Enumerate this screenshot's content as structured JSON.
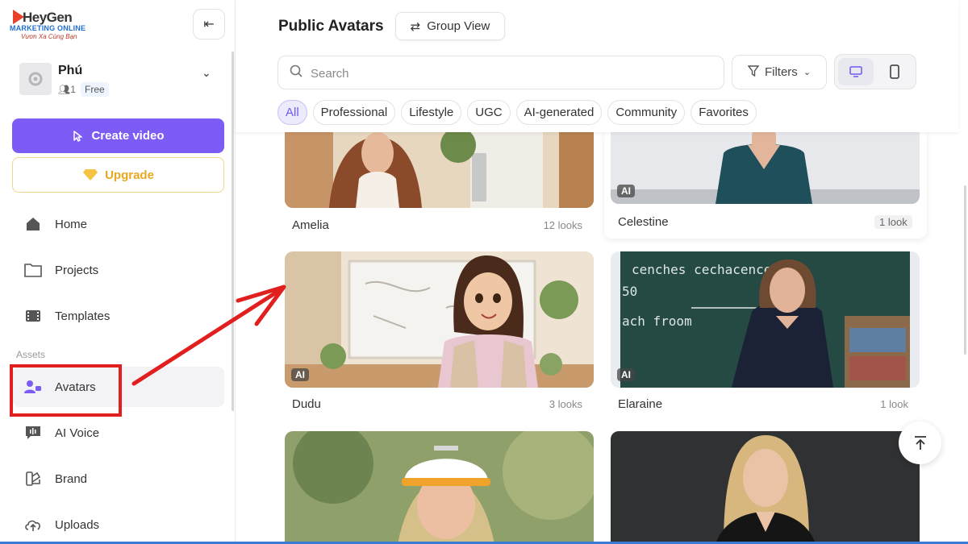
{
  "logo": {
    "top": "HeyGen",
    "mid": "MARKETING ONLINE",
    "sub": "Vươn Xa Cùng Bạn"
  },
  "user": {
    "name": "Phú",
    "count": "1",
    "plan": "Free"
  },
  "sidebar": {
    "create_label": "Create video",
    "upgrade_label": "Upgrade",
    "items": [
      {
        "label": "Home",
        "icon": "home-icon"
      },
      {
        "label": "Projects",
        "icon": "folder-icon"
      },
      {
        "label": "Templates",
        "icon": "film-icon"
      }
    ],
    "section_label": "Assets",
    "asset_items": [
      {
        "label": "Avatars",
        "icon": "avatar-icon",
        "active": true
      },
      {
        "label": "AI Voice",
        "icon": "voice-icon"
      },
      {
        "label": "Brand",
        "icon": "brand-icon"
      },
      {
        "label": "Uploads",
        "icon": "upload-icon"
      }
    ]
  },
  "header": {
    "title": "Public Avatars",
    "group_view_label": "Group View",
    "search_placeholder": "Search",
    "filters_label": "Filters"
  },
  "tabs": [
    "All",
    "Professional",
    "Lifestyle",
    "UGC",
    "AI-generated",
    "Community",
    "Favorites"
  ],
  "active_tab": "All",
  "avatars": [
    {
      "name": "Amelia",
      "looks": "12 looks",
      "ai": false
    },
    {
      "name": "Celestine",
      "looks": "1 look",
      "ai": true
    },
    {
      "name": "Dudu",
      "looks": "3 looks",
      "ai": true
    },
    {
      "name": "Elaraine",
      "looks": "1 look",
      "ai": true
    },
    {
      "name": "",
      "looks": "",
      "ai": false
    },
    {
      "name": "",
      "looks": "",
      "ai": false
    }
  ],
  "ai_badge_label": "AI",
  "colors": {
    "accent": "#7c5cf5",
    "upgrade": "#e9a720",
    "annotation": "#e21f1f"
  }
}
